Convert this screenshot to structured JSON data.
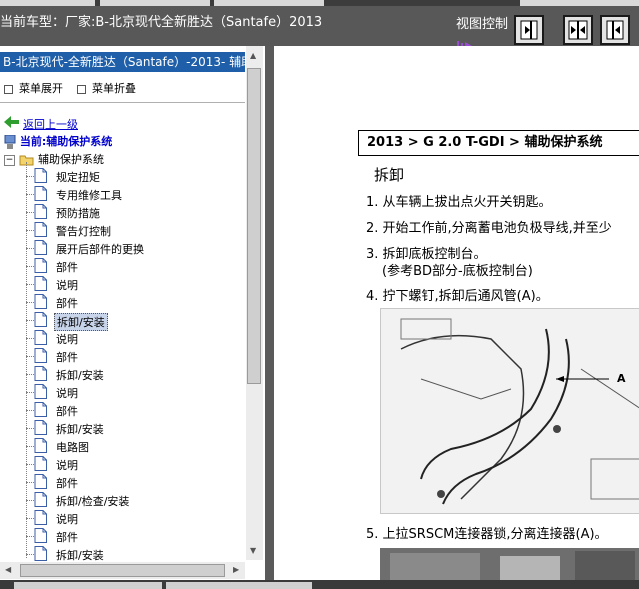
{
  "window": {
    "title": "当前车型：厂家:B-北京现代全新胜达（Santafe）2013",
    "view_control_label": "视图控制"
  },
  "left_pane": {
    "header": "B-北京现代-全新胜达（Santafe）-2013- 辅助保护系统",
    "toolbar": {
      "expand_label": "菜单展开",
      "collapse_label": "菜单折叠"
    },
    "back_link": "返回上一级",
    "current_label": "当前:辅助保护系统",
    "root_node": "辅助保护系统",
    "items": [
      {
        "label": "规定扭矩"
      },
      {
        "label": "专用维修工具"
      },
      {
        "label": "预防措施"
      },
      {
        "label": "警告灯控制"
      },
      {
        "label": "展开后部件的更换"
      },
      {
        "label": "部件"
      },
      {
        "label": "说明"
      },
      {
        "label": "部件"
      },
      {
        "label": "拆卸/安装"
      },
      {
        "label": "说明"
      },
      {
        "label": "部件"
      },
      {
        "label": "拆卸/安装"
      },
      {
        "label": "说明"
      },
      {
        "label": "部件"
      },
      {
        "label": "拆卸/安装"
      },
      {
        "label": "电路图"
      },
      {
        "label": "说明"
      },
      {
        "label": "部件"
      },
      {
        "label": "拆卸/检查/安装"
      },
      {
        "label": "说明"
      },
      {
        "label": "部件"
      },
      {
        "label": "拆卸/安装"
      }
    ],
    "selected_index": 8
  },
  "document": {
    "header": "2013 > G 2.0 T-GDI > 辅助保护系统",
    "section": "拆卸",
    "steps": [
      "1. 从车辆上拔出点火开关钥匙。",
      "2. 开始工作前,分离蓄电池负极导线,并至少",
      "3. 拆卸底板控制台。",
      "(参考BD部分-底板控制台)",
      "4. 拧下螺钉,拆卸后通风管(A)。",
      "5. 上拉SRSCM连接器锁,分离连接器(A)。"
    ],
    "figure_callout": "A"
  },
  "colors": {
    "header_blue": "#1f5fa9",
    "link_blue": "#0000cc",
    "selection": "#c8d4ea",
    "chrome_gray": "#585858"
  }
}
